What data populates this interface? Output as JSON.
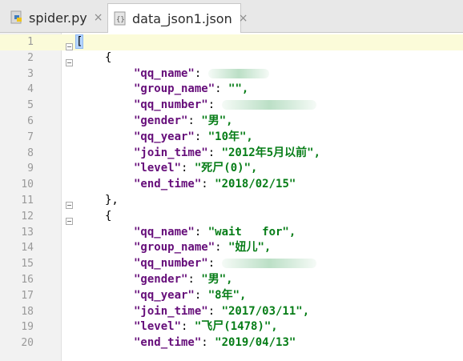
{
  "tabs": [
    {
      "label": "spider.py",
      "close": "×",
      "active": false
    },
    {
      "label": "data_json1.json",
      "close": "×",
      "active": true
    }
  ],
  "colors": {
    "key": "#660e7a",
    "string": "#067d17",
    "current_line": "#fbfbd9",
    "gutter": "#f2f2f2"
  },
  "icons": {
    "python_file": "python-file-icon",
    "json_file": "json-file-icon",
    "fold_marker": "fold-marker-icon"
  },
  "editor": {
    "lines": [
      {
        "n": "1",
        "t": "["
      },
      {
        "n": "2",
        "t": "{"
      },
      {
        "n": "3",
        "k": "\"qq_name\"",
        "v": ""
      },
      {
        "n": "4",
        "k": "\"group_name\"",
        "v": "\"\","
      },
      {
        "n": "5",
        "k": "\"qq_number\"",
        "v": ""
      },
      {
        "n": "6",
        "k": "\"gender\"",
        "v": "\"男\","
      },
      {
        "n": "7",
        "k": "\"qq_year\"",
        "v": "\"10年\","
      },
      {
        "n": "8",
        "k": "\"join_time\"",
        "v": "\"2012年5月以前\","
      },
      {
        "n": "9",
        "k": "\"level\"",
        "v": "\"死尸(0)\","
      },
      {
        "n": "10",
        "k": "\"end_time\"",
        "v": "\"2018/02/15\""
      },
      {
        "n": "11",
        "t": "},"
      },
      {
        "n": "12",
        "t": "{"
      },
      {
        "n": "13",
        "k": "\"qq_name\"",
        "v": "\"wait   for\","
      },
      {
        "n": "14",
        "k": "\"group_name\"",
        "v": "\"妞儿\","
      },
      {
        "n": "15",
        "k": "\"qq_number\"",
        "v": ""
      },
      {
        "n": "16",
        "k": "\"gender\"",
        "v": "\"男\","
      },
      {
        "n": "17",
        "k": "\"qq_year\"",
        "v": "\"8年\","
      },
      {
        "n": "18",
        "k": "\"join_time\"",
        "v": "\"2017/03/11\","
      },
      {
        "n": "19",
        "k": "\"level\"",
        "v": "\"飞尸(1478)\","
      },
      {
        "n": "20",
        "k": "\"end_time\"",
        "v": "\"2019/04/13\""
      }
    ]
  }
}
